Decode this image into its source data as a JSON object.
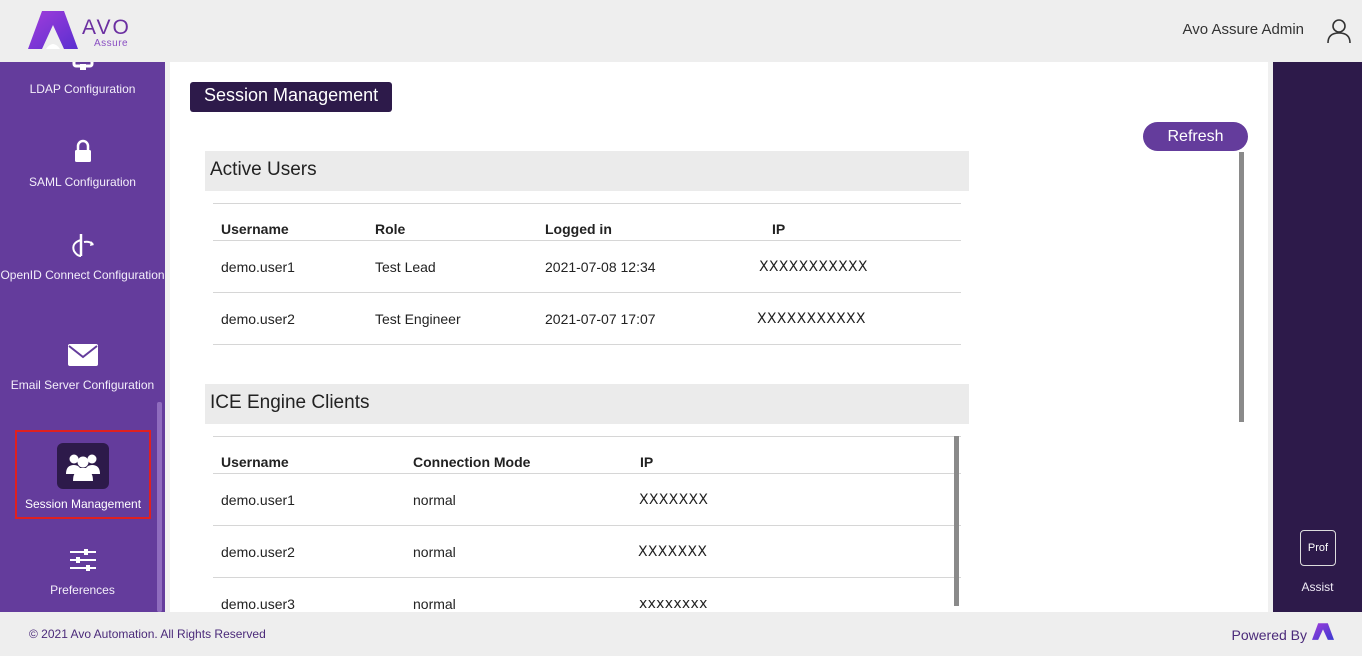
{
  "header": {
    "logo_text": "AVO",
    "logo_sub": "Assure",
    "user_name": "Avo Assure Admin"
  },
  "sidebar": {
    "items": [
      {
        "label": "LDAP Configuration",
        "icon": "ldap-icon"
      },
      {
        "label": "SAML Configuration",
        "icon": "lock-icon"
      },
      {
        "label": "OpenID Connect Configuration",
        "icon": "openid-icon"
      },
      {
        "label": "Email Server Configuration",
        "icon": "mail-icon"
      },
      {
        "label": "Session Management",
        "icon": "users-icon",
        "selected": true
      },
      {
        "label": "Preferences",
        "icon": "sliders-icon"
      }
    ]
  },
  "main": {
    "page_title": "Session Management",
    "refresh_label": "Refresh",
    "active_users": {
      "title": "Active Users",
      "columns": [
        "Username",
        "Role",
        "Logged in",
        "IP"
      ],
      "rows": [
        {
          "username": "demo.user1",
          "role": "Test Lead",
          "logged_in": "2021-07-08 12:34",
          "ip": "XXXXXXXXXXX"
        },
        {
          "username": "demo.user2",
          "role": "Test Engineer",
          "logged_in": "2021-07-07 17:07",
          "ip": "XXXXXXXXXXX"
        }
      ]
    },
    "ice_clients": {
      "title": "ICE Engine Clients",
      "columns": [
        "Username",
        "Connection Mode",
        "IP"
      ],
      "rows": [
        {
          "username": "demo.user1",
          "mode": "normal",
          "ip": "XXXXXXX"
        },
        {
          "username": "demo.user2",
          "mode": "normal",
          "ip": "XXXXXXX"
        },
        {
          "username": "demo.user3",
          "mode": "normal",
          "ip": "xxxxxxxx"
        }
      ]
    }
  },
  "right_panel": {
    "assist_icon_text": "Prof",
    "assist_label": "Assist"
  },
  "footer": {
    "copyright": "© 2021 Avo Automation. All Rights Reserved",
    "powered_by": "Powered By"
  },
  "colors": {
    "sidebar": "#643c9c",
    "dark_accent": "#2d1a4a",
    "selected_border": "#e02020"
  }
}
